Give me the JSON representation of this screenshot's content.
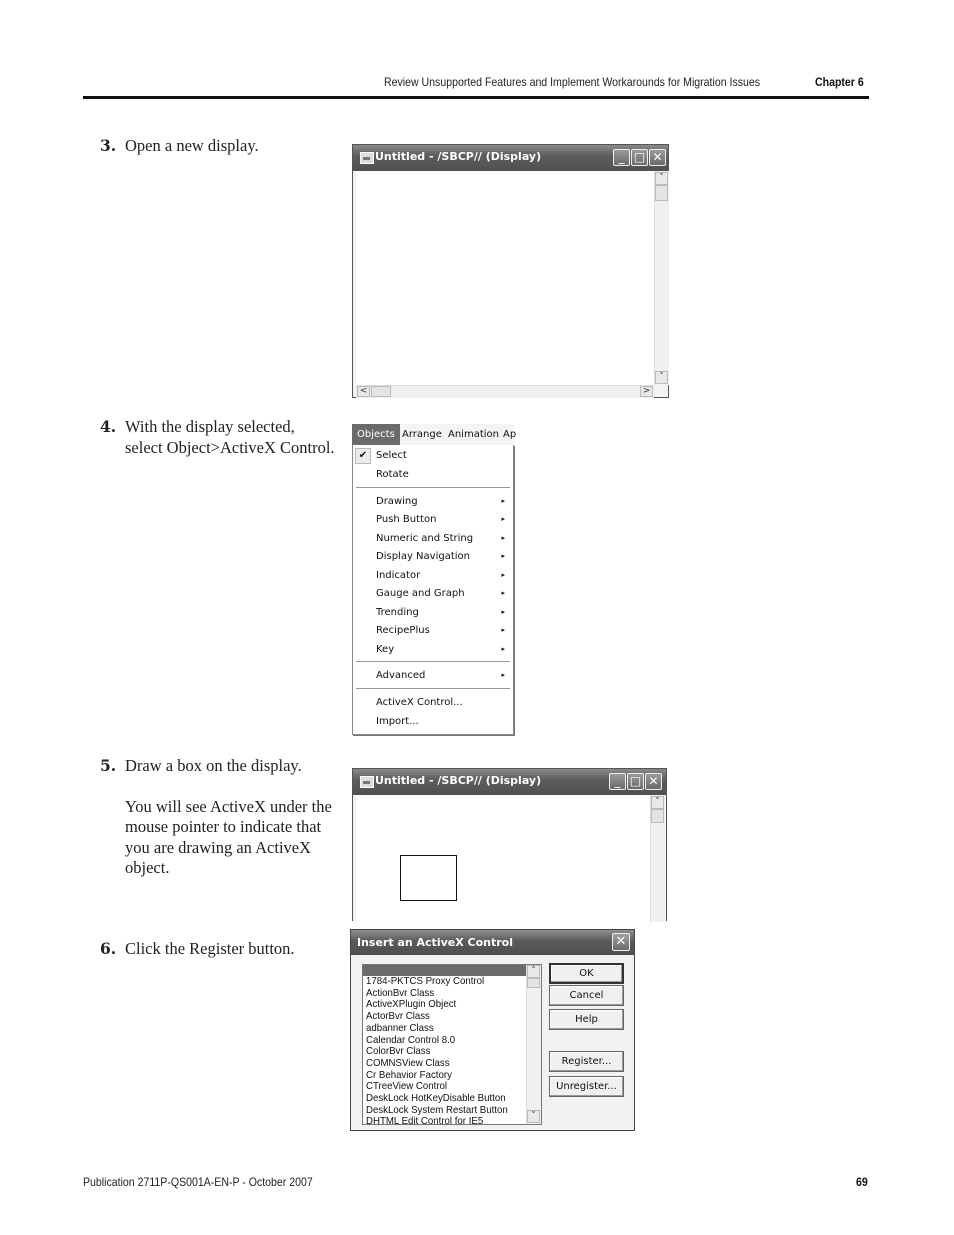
{
  "header": {
    "section_title": "Review Unsupported Features and Implement Workarounds for Migration Issues",
    "chapter": "Chapter 6"
  },
  "steps": [
    {
      "number": "3.",
      "text": "Open a new display."
    },
    {
      "number": "4.",
      "text": "With the display selected, select Object>ActiveX Control."
    },
    {
      "number": "5.",
      "text": "Draw a box on the display.",
      "note": "You will see ActiveX under the mouse pointer to indicate that you are drawing an ActiveX object."
    },
    {
      "number": "6.",
      "text": "Click the Register button."
    }
  ],
  "display_window_1": {
    "title": "Untitled - /SBCP// (Display)",
    "minimize": "_",
    "maximize": "□",
    "close": "✕",
    "scroll_up": "˄",
    "scroll_down": "˅",
    "scroll_left": "<",
    "scroll_right": ">"
  },
  "menu": {
    "menubar": [
      "Objects",
      "Arrange",
      "Animation",
      "Ap"
    ],
    "check_icon": "✔",
    "submenu_arrow": "▸",
    "items": [
      {
        "label": "Select",
        "checked": true,
        "submenu": false
      },
      {
        "label": "Rotate",
        "checked": false,
        "submenu": false
      },
      {
        "label": "Drawing",
        "submenu": true
      },
      {
        "label": "Push Button",
        "submenu": true
      },
      {
        "label": "Numeric and  String",
        "submenu": true
      },
      {
        "label": "Display Navigation",
        "submenu": true
      },
      {
        "label": "Indicator",
        "submenu": true
      },
      {
        "label": "Gauge and Graph",
        "submenu": true
      },
      {
        "label": "Trending",
        "submenu": true
      },
      {
        "label": "RecipePlus",
        "submenu": true
      },
      {
        "label": "Key",
        "submenu": true
      },
      {
        "label": "Advanced",
        "submenu": true
      },
      {
        "label": "ActiveX Control...",
        "submenu": false
      },
      {
        "label": "Import...",
        "submenu": false
      }
    ]
  },
  "display_window_2": {
    "title": "Untitled - /SBCP// (Display)",
    "minimize": "_",
    "maximize": "□",
    "close": "✕",
    "scroll_up": "˄"
  },
  "dialog": {
    "title": "Insert an ActiveX Control",
    "close": "✕",
    "list_items": [
      "1784-PKTCS Proxy Control",
      "ActionBvr Class",
      "ActiveXPlugin Object",
      "ActorBvr Class",
      "adbanner Class",
      "Calendar Control 8.0",
      "ColorBvr Class",
      "COMNSView Class",
      "Cr Behavior Factory",
      "CTreeView Control",
      "DeskLock HotKeyDisable Button",
      "DeskLock System Restart Button",
      "DHTML Edit Control for IE5"
    ],
    "buttons": {
      "ok": "OK",
      "cancel": "Cancel",
      "help": "Help",
      "register": "Register...",
      "unregister": "Unregister..."
    },
    "scroll_up": "˄",
    "scroll_down": "˅"
  },
  "footer": {
    "publication": "Publication 2711P-QS001A-EN-P - October 2007",
    "page_number": "69"
  }
}
